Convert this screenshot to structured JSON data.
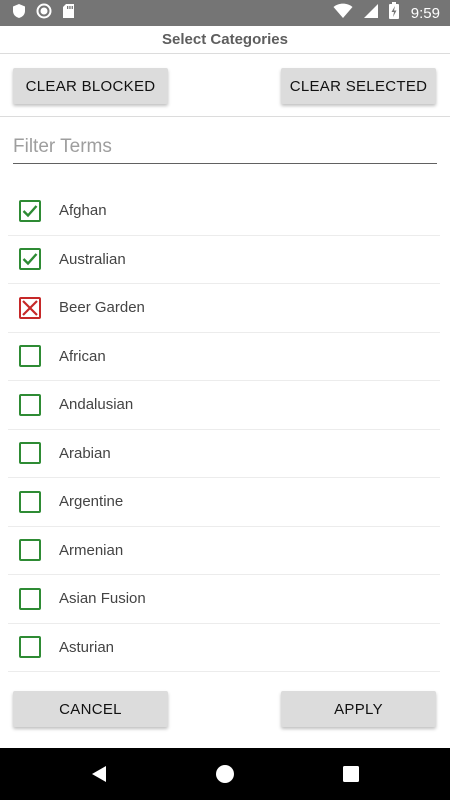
{
  "status_bar": {
    "time": "9:59",
    "icons": [
      "shield-icon",
      "circle-icon",
      "sd-card-icon",
      "wifi-icon",
      "signal-icon",
      "battery-charging-icon"
    ]
  },
  "title": "Select Categories",
  "buttons": {
    "clear_blocked": "CLEAR BLOCKED",
    "clear_selected": "CLEAR SELECTED",
    "cancel": "CANCEL",
    "apply": "APPLY"
  },
  "filter": {
    "placeholder": "Filter Terms",
    "value": ""
  },
  "categories": [
    {
      "label": "Afghan",
      "state": "selected"
    },
    {
      "label": "Australian",
      "state": "selected"
    },
    {
      "label": "Beer Garden",
      "state": "blocked"
    },
    {
      "label": "African",
      "state": "unchecked"
    },
    {
      "label": "Andalusian",
      "state": "unchecked"
    },
    {
      "label": "Arabian",
      "state": "unchecked"
    },
    {
      "label": "Argentine",
      "state": "unchecked"
    },
    {
      "label": "Armenian",
      "state": "unchecked"
    },
    {
      "label": "Asian Fusion",
      "state": "unchecked"
    },
    {
      "label": "Asturian",
      "state": "unchecked"
    }
  ],
  "colors": {
    "selected": "#2e8b34",
    "blocked": "#c62828",
    "status_bar": "#757575",
    "nav_bar": "#000000",
    "button": "#dcdcdc"
  },
  "nav_bar": {
    "icons": [
      "back-icon",
      "home-icon",
      "recents-icon"
    ]
  }
}
